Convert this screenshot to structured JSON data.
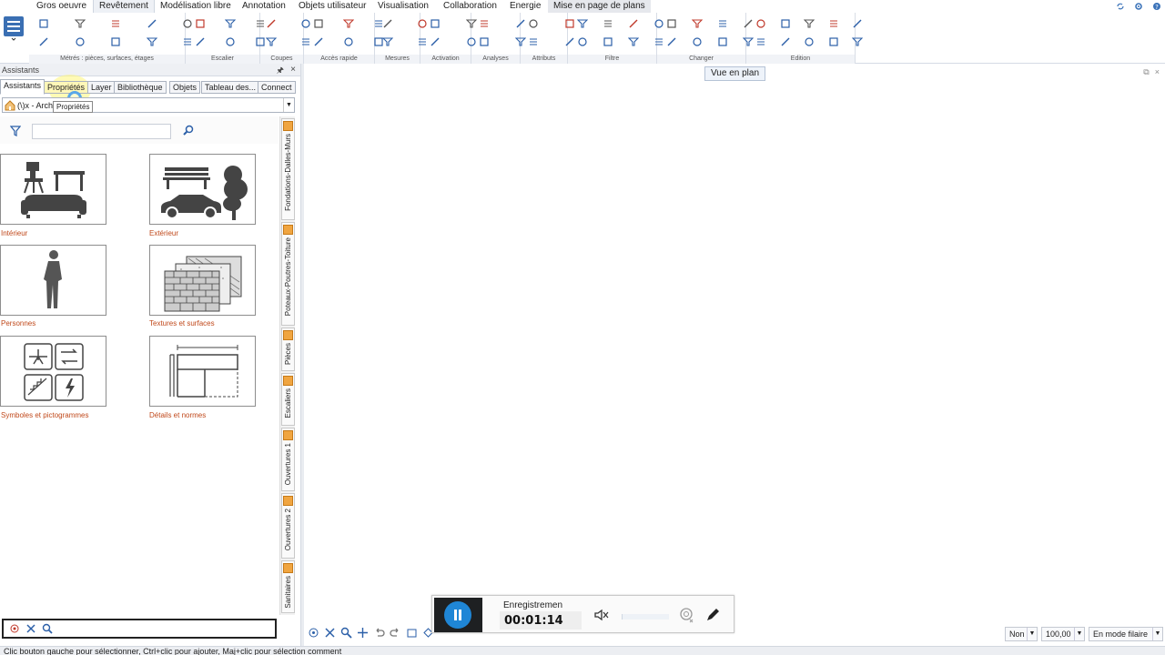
{
  "menu": {
    "items": [
      "Gros oeuvre",
      "Revêtement",
      "Modélisation libre",
      "Annotation",
      "Objets utilisateur",
      "Visualisation",
      "Collaboration",
      "Energie",
      "Mise en page de plans"
    ],
    "active": "Revêtement"
  },
  "ribbon": {
    "groups": [
      "Métrés : pièces, surfaces, étages",
      "Escalier",
      "Coupes",
      "Accès rapide",
      "Mesures",
      "Activation",
      "Analyses",
      "Attributs",
      "Filtre",
      "Changer",
      "Edition"
    ]
  },
  "assistants_panel": {
    "title": "Assistants",
    "pin": "ᵖ",
    "close": "×",
    "tabs": [
      "Assistants",
      "Propriétés",
      "Layer",
      "Bibliothèque",
      "Objets",
      "Tableau des...",
      "Connect"
    ],
    "tooltip": "Propriétés",
    "combo_value": "(\\)x - Arch",
    "combo_arrow": "▼",
    "search_placeholder": "",
    "tiles": [
      {
        "label": "Intérieur",
        "icon": "interior-furniture-icon"
      },
      {
        "label": "Extérieur",
        "icon": "exterior-car-tree-icon"
      },
      {
        "label": "Personnes",
        "icon": "person-icon"
      },
      {
        "label": "Textures et surfaces",
        "icon": "brick-texture-icon"
      },
      {
        "label": "Symboles et pictogrammes",
        "icon": "symbols-icon"
      },
      {
        "label": "Détails et normes",
        "icon": "details-drawing-icon"
      }
    ],
    "vertical_tabs": [
      "Fondations-Dalles-Murs",
      "Poteaux-Poutres-Toiture",
      "Pièces",
      "Escaliers",
      "Ouvertures 1",
      "Ouvertures 2",
      "Sanitaires"
    ]
  },
  "view": {
    "badge": "Vue en plan",
    "win_buttons": [
      "⧉",
      "×"
    ]
  },
  "recorder": {
    "title": "Enregistremen",
    "time": "00:01:14"
  },
  "status_combos": [
    {
      "value": "Non",
      "arrow": "▼"
    },
    {
      "value": "100,00",
      "arrow": "▼"
    },
    {
      "value": "En mode filaire",
      "arrow": "▼"
    }
  ],
  "statusline": "Clic bouton gauche pour sélectionner, Ctrl+clic pour ajouter, Maj+clic pour sélection comment"
}
